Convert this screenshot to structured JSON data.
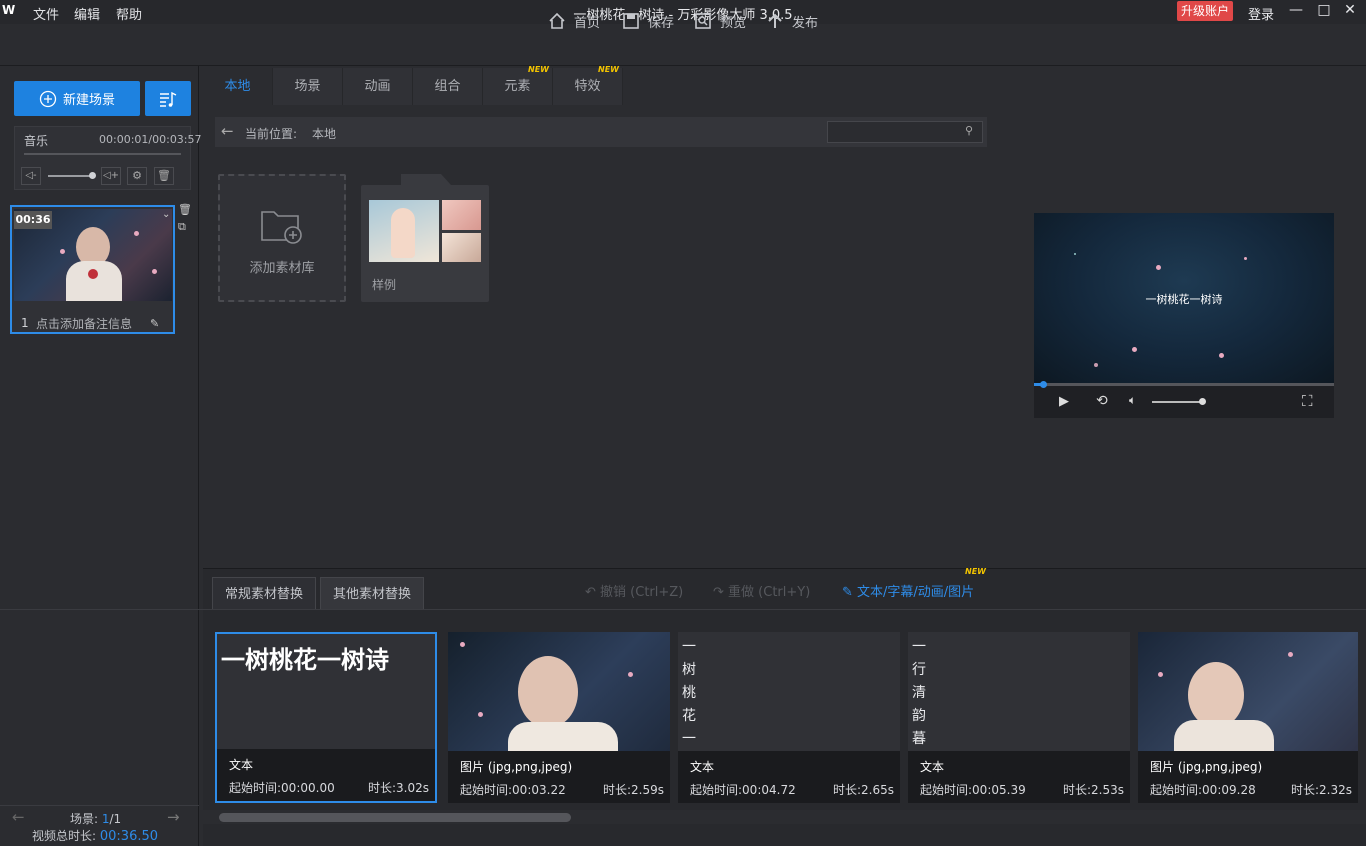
{
  "titlebar": {
    "logo": "W",
    "menu": [
      "文件",
      "编辑",
      "帮助"
    ],
    "title": "一树桃花一树诗 - 万彩影像大师 3.0.5",
    "upgrade": "升级账户",
    "login": "登录"
  },
  "toolbar": {
    "home": "首页",
    "save": "保存",
    "preview": "预览",
    "publish": "发布"
  },
  "left": {
    "new_scene": "新建场景",
    "music_label": "音乐",
    "music_time": "00:00:01/00:03:57",
    "scene_time": "00:36",
    "scene_index": "1",
    "scene_note": "点击添加备注信息",
    "scene_count_label": "场景:",
    "scene_current": "1",
    "scene_total": "/1",
    "total_label": "视频总时长:",
    "total_value": "00:36.50"
  },
  "tabs": [
    {
      "label": "本地",
      "active": true
    },
    {
      "label": "场景"
    },
    {
      "label": "动画"
    },
    {
      "label": "组合"
    },
    {
      "label": "元素",
      "badge": "NEW"
    },
    {
      "label": "特效",
      "badge": "NEW"
    }
  ],
  "path": {
    "label": "当前位置:",
    "value": "本地",
    "search_placeholder": ""
  },
  "library": {
    "add_label": "添加素材库",
    "sample_label": "样例"
  },
  "preview": {
    "text": "一树桃花一树诗",
    "progress": 0.03
  },
  "bottom": {
    "tab_regular": "常规素材替换",
    "tab_other": "其他素材替换",
    "undo": "撤销 (Ctrl+Z)",
    "redo": "重做 (Ctrl+Y)",
    "edit_link": "文本/字幕/动画/图片",
    "edit_badge": "NEW"
  },
  "cards": [
    {
      "preview_text": "一树桃花一树诗",
      "name": "文本",
      "start": "起始时间:00:00.00",
      "duration": "时长:3.02s",
      "type": "text-h"
    },
    {
      "name": "图片 (jpg,png,jpeg)",
      "start": "起始时间:00:03.22",
      "duration": "时长:2.59s",
      "type": "image"
    },
    {
      "preview_text": "一树桃花一",
      "name": "文本",
      "start": "起始时间:00:04.72",
      "duration": "时长:2.65s",
      "type": "text-v"
    },
    {
      "preview_text": "一行清韵暮",
      "name": "文本",
      "start": "起始时间:00:05.39",
      "duration": "时长:2.53s",
      "type": "text-v"
    },
    {
      "name": "图片 (jpg,png,jpeg)",
      "start": "起始时间:00:09.28",
      "duration": "时长:2.32s",
      "type": "image"
    }
  ]
}
